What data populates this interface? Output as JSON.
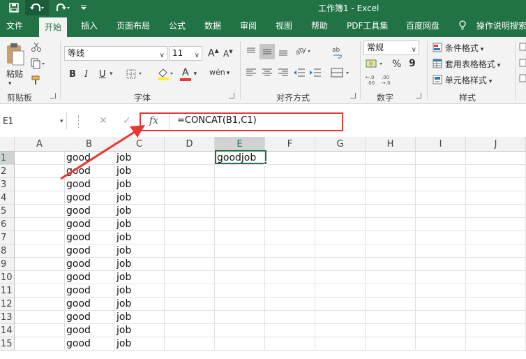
{
  "window": {
    "title": "工作簿1  -  Excel"
  },
  "qat": {
    "save_icon": "save-icon",
    "undo_icon": "undo-icon",
    "redo_icon": "redo-icon",
    "customize_icon": "customize-qat-icon"
  },
  "tabs": [
    "文件",
    "开始",
    "插入",
    "页面布局",
    "公式",
    "数据",
    "审阅",
    "视图",
    "帮助",
    "PDF工具集",
    "百度网盘"
  ],
  "tell_me": "操作说明搜索",
  "ribbon": {
    "clipboard": {
      "paste": "粘贴",
      "label": "剪贴板"
    },
    "font": {
      "name": "等线",
      "size": "11",
      "grow": "A",
      "shrink": "A",
      "bold": "B",
      "italic": "I",
      "underline": "U",
      "color_a": "A",
      "phonetic": "wén",
      "label": "字体"
    },
    "alignment": {
      "label": "对齐方式"
    },
    "number": {
      "format": "常规",
      "percent": "%",
      "comma": "9",
      "label": "数字"
    },
    "styles": {
      "conditional": "条件格式",
      "table": "套用表格格式",
      "cell": "单元格样式",
      "label": "样式"
    }
  },
  "formula_bar": {
    "name_box": "E1",
    "cancel": "✕",
    "enter": "✓",
    "fx": "fx",
    "formula": "=CONCAT(B1,C1)"
  },
  "columns": [
    "A",
    "B",
    "C",
    "D",
    "E",
    "F",
    "G",
    "H",
    "I",
    "J"
  ],
  "rows": [
    "1",
    "2",
    "3",
    "4",
    "5",
    "6",
    "7",
    "8",
    "9",
    "10",
    "11",
    "12",
    "13",
    "14",
    "15"
  ],
  "cells": {
    "B": [
      "good",
      "good",
      "good",
      "good",
      "good",
      "good",
      "good",
      "good",
      "good",
      "good",
      "good",
      "good",
      "good",
      "good",
      "good"
    ],
    "C": [
      "job",
      "job",
      "job",
      "job",
      "job",
      "job",
      "job",
      "job",
      "job",
      "job",
      "job",
      "job",
      "job",
      "job",
      "job"
    ],
    "E1": "goodjob"
  },
  "colors": {
    "accent": "#217346",
    "highlight": "#e53935"
  }
}
